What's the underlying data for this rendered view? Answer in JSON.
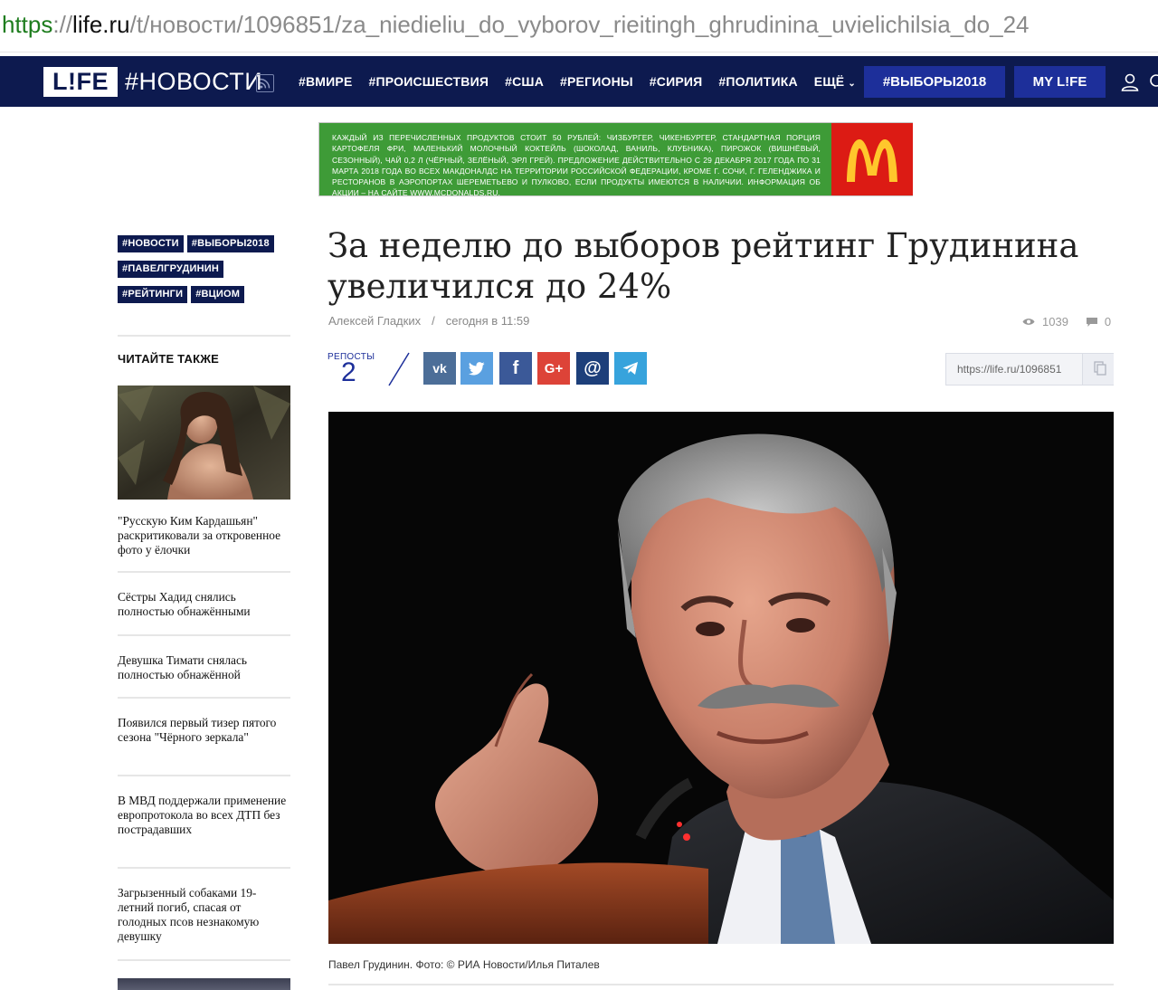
{
  "browser": {
    "url_scheme": "https",
    "url_sep": "://",
    "url_host": "life.ru",
    "url_path": "/t/новости/1096851/za_niedieliu_do_vyborov_rieitingh_ghrudinina_uvielichilsia_do_24"
  },
  "header": {
    "logo": "L!FE",
    "section": "#НОВОСТИ",
    "nav": [
      "#ВМИРЕ",
      "#ПРОИСШЕСТВИЯ",
      "#США",
      "#РЕГИОНЫ",
      "#СИРИЯ",
      "#ПОЛИТИКА",
      "ЕЩЁ"
    ],
    "elections_button": "#ВЫБОРЫ2018",
    "mylife_button": "MY L!FE"
  },
  "ad": {
    "text": "Каждый из перечисленных продуктов стоит 50 рублей: чизбургер, чикенбургер, стандартная порция картофеля фри, маленький молочный коктейль (шоколад, ваниль, клубника), пирожок (вишнёвый, сезонный), чай 0,2 л (чёрный, зелёный, эрл грей). Предложение действительно с 29 декабря 2017 года по 31 марта 2018 года во всех Макдоналдс на территории Российской Федерации, кроме г. Сочи, г. Геленджика и ресторанов в аэропортах Шереметьево и Пулково, если продукты имеются в наличии. Информация об акции – на сайте www.mcdonalds.ru.",
    "brand": "McDonald's",
    "colors": {
      "green": "#3e9b37",
      "red": "#dc1b14",
      "yellow": "#ffc72c"
    }
  },
  "tags": [
    "#НОВОСТИ",
    "#ВЫБОРЫ2018",
    "#ПАВЕЛГРУДИНИН",
    "#РЕЙТИНГИ",
    "#ВЦИОМ"
  ],
  "sidebar": {
    "heading": "ЧИТАЙТЕ ТАКЖЕ",
    "items": [
      "\"Русскую Ким Кардашьян\" раскритиковали за откровенное фото у ёлочки",
      "Сёстры Хадид снялись полностью обнажёнными",
      "Девушка Тимати снялась полностью обнажённой",
      "Появился первый тизер пятого сезона \"Чёрного зеркала\"",
      "В МВД поддержали применение европротокола во всех ДТП без пострадавших",
      "Загрызенный собаками 19-летний погиб, спасая от голодных псов незнакомую девушку"
    ]
  },
  "article": {
    "title": "За неделю до выборов рейтинг Грудинина увеличился до 24%",
    "author": "Алексей Гладких",
    "separator": "/",
    "time": "сегодня в 11:59",
    "views": "1039",
    "comments": "0",
    "reposts_label": "РЕПОСТЫ",
    "reposts": "2",
    "short_url": "https://life.ru/1096851",
    "caption": "Павел Грудинин. Фото: © РИА Новости/Илья Питалев"
  },
  "share_buttons": [
    "vk-icon",
    "twitter-icon",
    "facebook-icon",
    "google-plus-icon",
    "mail-icon",
    "telegram-icon"
  ],
  "colors": {
    "navy": "#0d1a4f",
    "blue_button": "#1d2f9a"
  }
}
